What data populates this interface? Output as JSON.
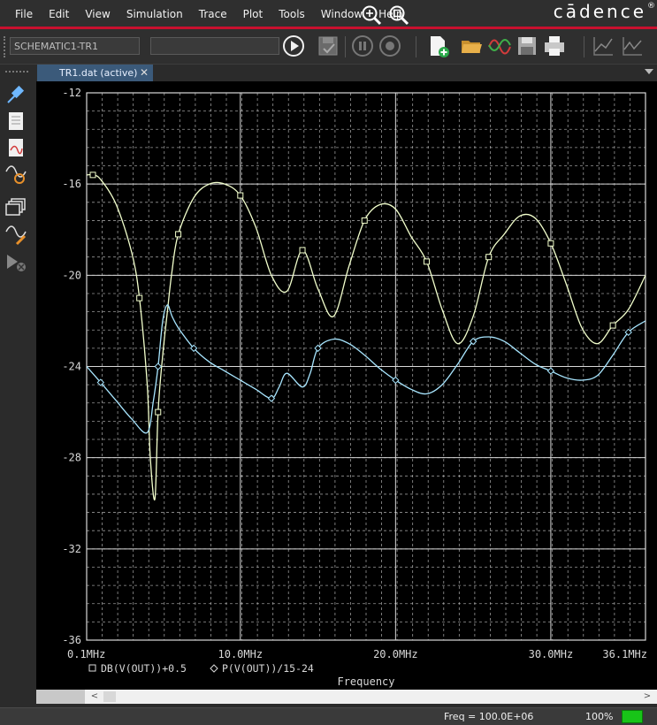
{
  "menubar": {
    "items": [
      "File",
      "Edit",
      "View",
      "Simulation",
      "Trace",
      "Plot",
      "Tools",
      "Window",
      "Help"
    ],
    "brand": "cādence",
    "brand_mark": "®",
    "icons": [
      "zoom-in-icon",
      "zoom-fit-icon"
    ]
  },
  "toolbar": {
    "profile_value": "SCHEMATIC1-TR1",
    "second_field_value": "",
    "icons": [
      "run-icon",
      "check-icon",
      "pause-icon",
      "stop-icon",
      "new-file-icon",
      "open-folder-icon",
      "waveform-icon",
      "save-icon",
      "print-icon",
      "cursor-a-icon",
      "cursor-b-icon"
    ]
  },
  "tabs": [
    {
      "label": "TR1.dat (active)",
      "close": "✕",
      "active": true
    }
  ],
  "left_panel": {
    "icons": [
      "pin-icon",
      "document-icon",
      "output-icon",
      "probe-search-icon",
      "windows-icon",
      "trace-edit-icon",
      "marker-icon"
    ]
  },
  "colors": {
    "plot_bg": "#000000",
    "grid": "#d8d8d8",
    "trace1": "#f2ffcc",
    "trace2": "#a8e6ff",
    "axis_text": "#d8d8d8",
    "brand_red": "#c8102e",
    "tab_active": "#3b5a7a",
    "status_ok": "#18c418"
  },
  "chart_data": {
    "type": "line",
    "xlabel": "Frequency",
    "ylabel": "",
    "x_unit": "Hz",
    "xlim": [
      100000,
      36100000
    ],
    "ylim": [
      -36,
      -12
    ],
    "y_ticks": [
      -12,
      -16,
      -20,
      -24,
      -28,
      -32,
      -36
    ],
    "x_tick_labels": [
      "0.1MHz",
      "10.0MHz",
      "20.0MHz",
      "30.0MHz",
      "36.1MHz"
    ],
    "x_tick_values": [
      100000,
      10000000,
      20000000,
      30000000,
      36100000
    ],
    "grid": true,
    "legend_position": "bottom-left",
    "series": [
      {
        "name": "DB(V(OUT))+0.5",
        "marker": "square",
        "color": "#f2ffcc",
        "x": [
          0.1,
          0.5,
          1.0,
          2.0,
          3.0,
          3.5,
          4.0,
          4.2,
          4.5,
          4.7,
          5.0,
          5.3,
          5.6,
          6.0,
          7.0,
          8.0,
          9.0,
          10.0,
          11.0,
          12.0,
          13.0,
          14.0,
          15.0,
          16.0,
          17.0,
          18.0,
          19.0,
          20.0,
          21.0,
          22.0,
          23.0,
          24.0,
          25.0,
          26.0,
          27.0,
          28.0,
          29.0,
          30.0,
          31.0,
          32.0,
          33.0,
          34.0,
          35.0,
          36.1
        ],
        "y": [
          -15.6,
          -15.6,
          -15.8,
          -16.9,
          -19.0,
          -21.0,
          -24.8,
          -28.0,
          -29.8,
          -26.0,
          -23.5,
          -21.6,
          -19.8,
          -18.2,
          -16.6,
          -16.0,
          -16.0,
          -16.5,
          -17.9,
          -20.0,
          -20.7,
          -18.9,
          -20.6,
          -21.8,
          -19.6,
          -17.6,
          -16.9,
          -17.1,
          -18.3,
          -19.4,
          -21.5,
          -23.0,
          -21.8,
          -19.2,
          -18.2,
          -17.4,
          -17.5,
          -18.6,
          -20.4,
          -22.3,
          -23.0,
          -22.2,
          -21.5,
          -20.0
        ]
      },
      {
        "name": "P(V(OUT))/15-24",
        "marker": "diamond",
        "color": "#a8e6ff",
        "x": [
          0.1,
          1.0,
          2.0,
          3.0,
          4.0,
          4.4,
          4.7,
          5.0,
          5.3,
          5.6,
          6.0,
          7.0,
          8.0,
          9.0,
          10.0,
          11.0,
          12.0,
          12.5,
          13.0,
          14.0,
          14.5,
          15.0,
          16.0,
          17.0,
          18.0,
          19.0,
          20.0,
          21.0,
          22.0,
          23.0,
          24.0,
          25.0,
          26.0,
          27.0,
          28.0,
          29.0,
          30.0,
          31.0,
          32.0,
          33.0,
          34.0,
          35.0,
          36.1
        ],
        "y": [
          -24.0,
          -24.7,
          -25.5,
          -26.3,
          -26.9,
          -25.5,
          -24.0,
          -22.0,
          -21.3,
          -21.8,
          -22.3,
          -23.2,
          -23.8,
          -24.2,
          -24.6,
          -25.0,
          -25.4,
          -24.9,
          -24.3,
          -24.9,
          -24.3,
          -23.2,
          -22.8,
          -23.0,
          -23.5,
          -24.1,
          -24.6,
          -25.0,
          -25.2,
          -24.8,
          -23.9,
          -22.9,
          -22.7,
          -22.9,
          -23.4,
          -23.9,
          -24.2,
          -24.5,
          -24.6,
          -24.4,
          -23.5,
          -22.5,
          -22.0
        ]
      }
    ]
  },
  "status": {
    "freq_text": "Freq =  100.0E+06",
    "zoom_text": "100%"
  }
}
